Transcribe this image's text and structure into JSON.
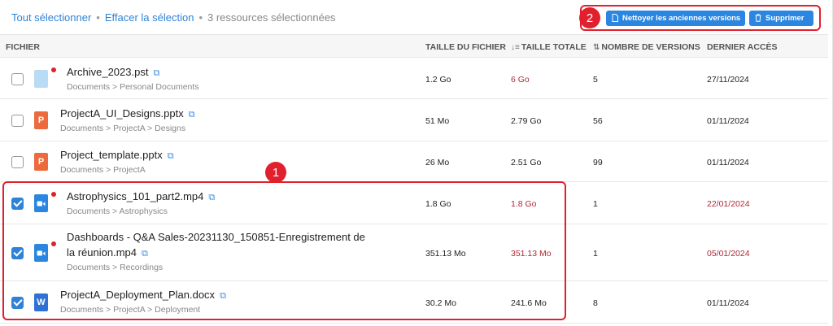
{
  "selection": {
    "select_all": "Tout sélectionner",
    "clear_selection": "Effacer la sélection",
    "count_text": "3 ressources sélectionnées"
  },
  "actions": {
    "clean_label": "Nettoyer les anciennes versions",
    "delete_label": "Supprimer"
  },
  "annotations": {
    "badge_1": "1",
    "badge_2": "2"
  },
  "columns": {
    "file": "FICHIER",
    "file_size": "TAILLE DU FICHIER",
    "total_size": "TAILLE TOTALE",
    "versions": "NOMBRE DE VERSIONS",
    "last_access": "DERNIER ACCÈS"
  },
  "rows": [
    {
      "name": "Archive_2023.pst",
      "path": "Documents > Personal Documents",
      "file_size": "1.2 Go",
      "total_size": "6 Go",
      "versions": "5",
      "last_access": "27/11/2024",
      "checked": false,
      "icon": "generic-file-icon",
      "flag": true,
      "total_red": true,
      "access_red": false
    },
    {
      "name": "ProjectA_UI_Designs.pptx",
      "path": "Documents > ProjectA > Designs",
      "file_size": "51 Mo",
      "total_size": "2.79 Go",
      "versions": "56",
      "last_access": "01/11/2024",
      "checked": false,
      "icon": "powerpoint-icon",
      "flag": false,
      "total_red": false,
      "access_red": false
    },
    {
      "name": "Project_template.pptx",
      "path": "Documents > ProjectA",
      "file_size": "26 Mo",
      "total_size": "2.51 Go",
      "versions": "99",
      "last_access": "01/11/2024",
      "checked": false,
      "icon": "powerpoint-icon",
      "flag": false,
      "total_red": false,
      "access_red": false
    },
    {
      "name": "Astrophysics_101_part2.mp4",
      "path": "Documents > Astrophysics",
      "file_size": "1.8 Go",
      "total_size": "1.8 Go",
      "versions": "1",
      "last_access": "22/01/2024",
      "checked": true,
      "icon": "video-icon",
      "flag": true,
      "total_red": true,
      "access_red": true
    },
    {
      "name": "Dashboards - Q&A Sales-20231130_150851-Enregistrement de la réunion.mp4",
      "path": "Documents > Recordings",
      "file_size": "351.13 Mo",
      "total_size": "351.13 Mo",
      "versions": "1",
      "last_access": "05/01/2024",
      "checked": true,
      "icon": "video-icon",
      "flag": true,
      "total_red": true,
      "access_red": true
    },
    {
      "name": "ProjectA_Deployment_Plan.docx",
      "path": "Documents > ProjectA > Deployment",
      "file_size": "30.2 Mo",
      "total_size": "241.6 Mo",
      "versions": "8",
      "last_access": "01/11/2024",
      "checked": true,
      "icon": "word-icon",
      "flag": false,
      "total_red": false,
      "access_red": false
    }
  ],
  "colors": {
    "accent": "#2a86e0",
    "link": "#2f83d6",
    "highlight": "#e0202c",
    "warning_text": "#b0283a"
  }
}
